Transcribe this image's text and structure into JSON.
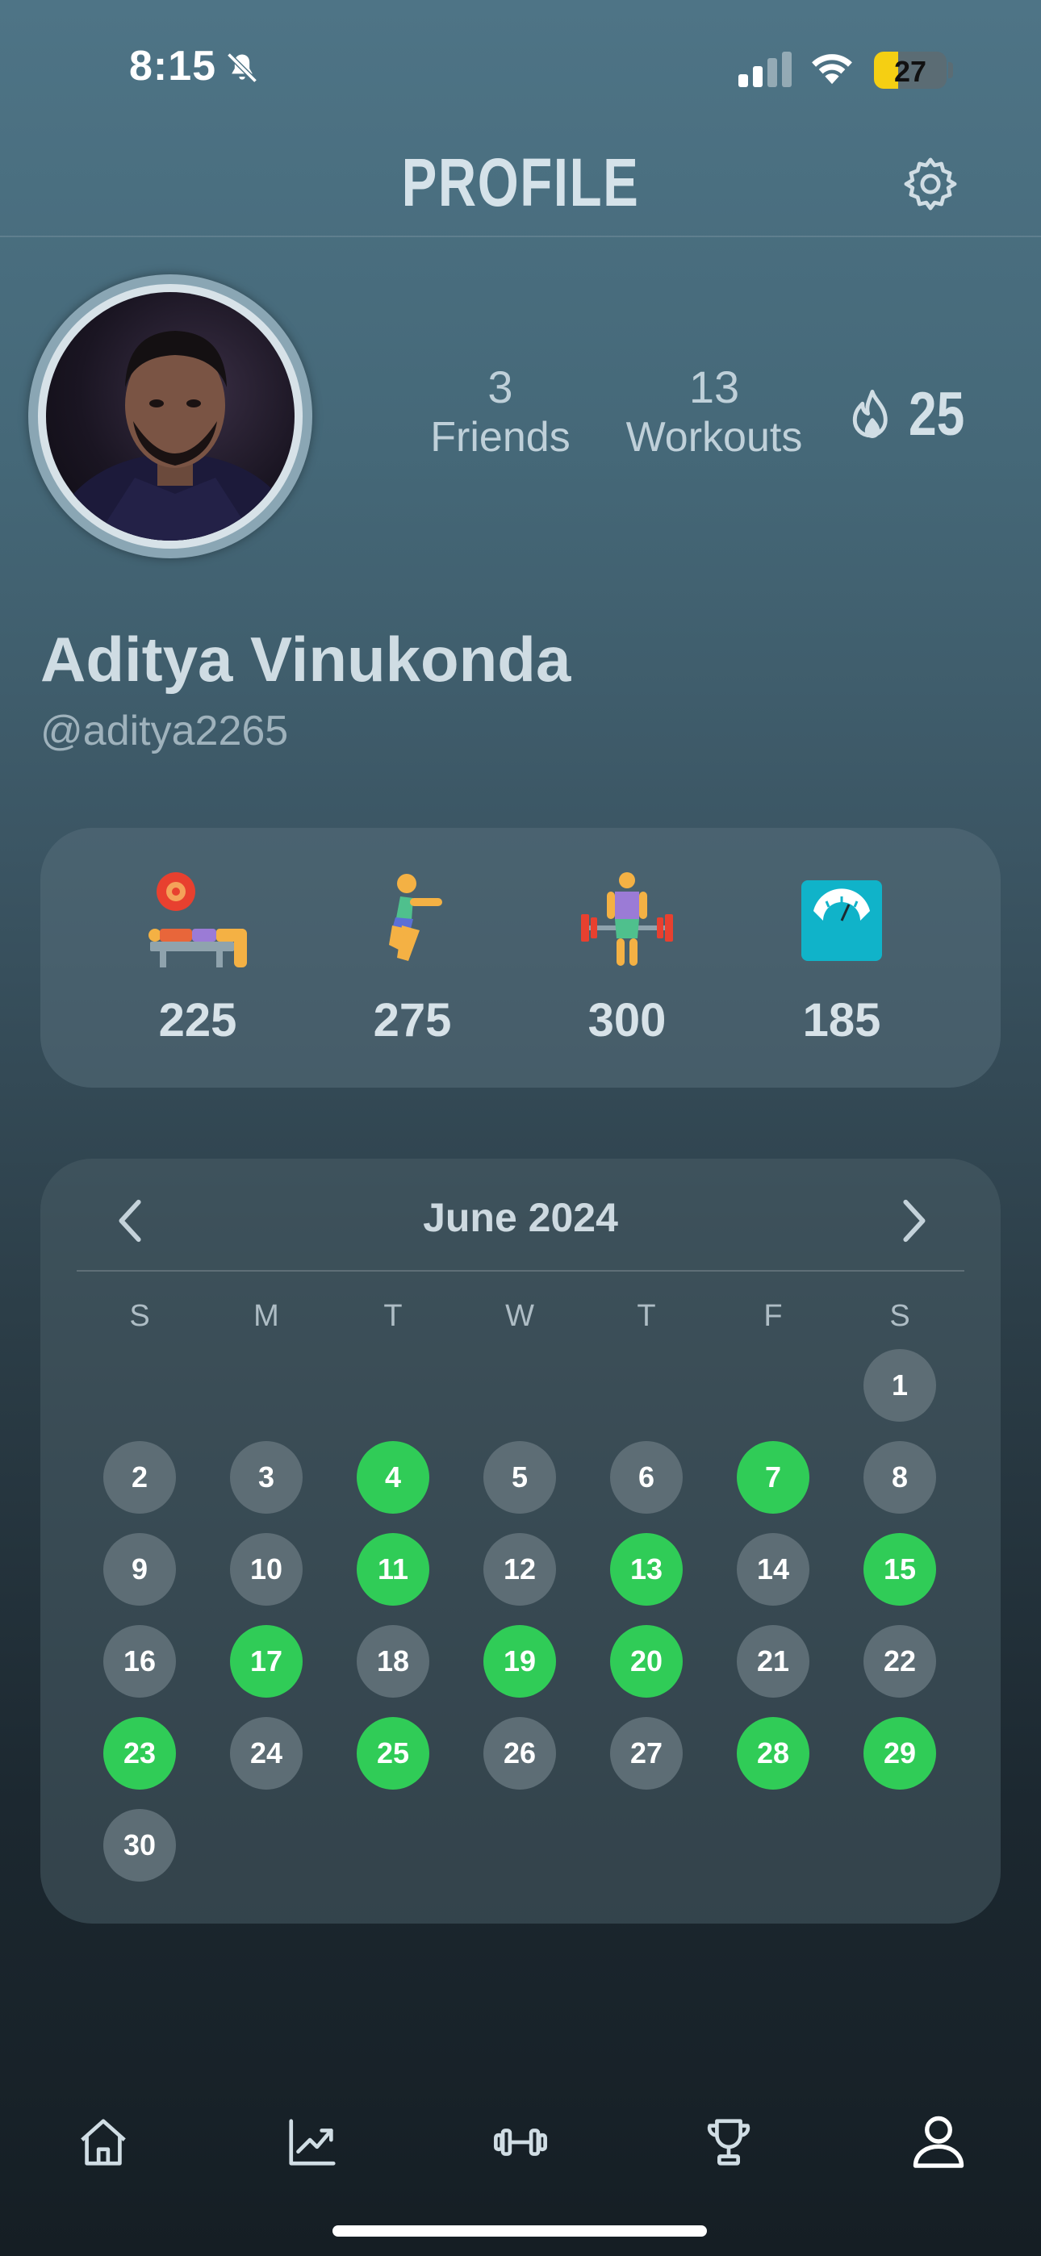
{
  "status_bar": {
    "time": "8:15",
    "battery": "27"
  },
  "header": {
    "title": "PROFILE"
  },
  "profile": {
    "friends_count": "3",
    "friends_label": "Friends",
    "workouts_count": "13",
    "workouts_label": "Workouts",
    "streak": "25",
    "name": "Aditya Vinukonda",
    "handle": "@aditya2265"
  },
  "personal_records": [
    {
      "icon": "bench-press-icon",
      "value": "225"
    },
    {
      "icon": "squat-icon",
      "value": "275"
    },
    {
      "icon": "deadlift-icon",
      "value": "300"
    },
    {
      "icon": "weight-scale-icon",
      "value": "185"
    }
  ],
  "calendar": {
    "month_label": "June 2024",
    "weekdays": [
      "S",
      "M",
      "T",
      "W",
      "T",
      "F",
      "S"
    ],
    "first_weekday_index": 6,
    "days_in_month": 30,
    "active_days": [
      4,
      7,
      11,
      13,
      15,
      17,
      19,
      20,
      23,
      25,
      28,
      29
    ],
    "active_color": "#30cc57",
    "inactive_color": "#5d6d75"
  },
  "tab_bar": {
    "items": [
      "home-icon",
      "stats-chart-icon",
      "workout-dumbbell-icon",
      "trophy-icon",
      "profile-icon"
    ],
    "active": "profile-icon"
  }
}
